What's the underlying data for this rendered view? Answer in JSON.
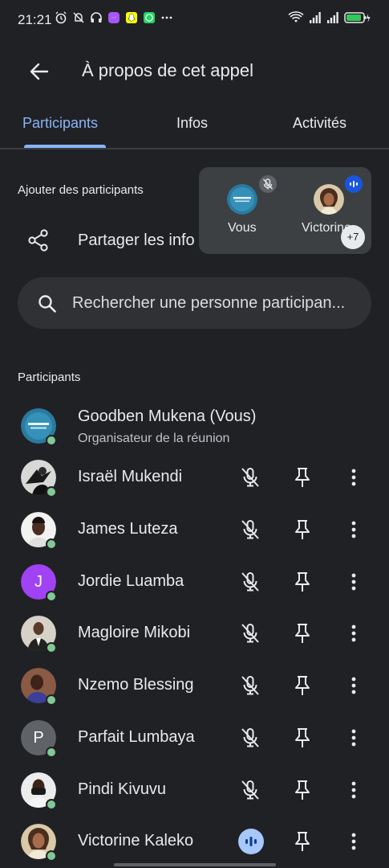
{
  "status_bar": {
    "time": "21:21",
    "icons": [
      "alarm-icon",
      "dnd-icon",
      "headphones-icon",
      "messenger-icon",
      "snapchat-icon",
      "whatsapp-icon",
      "more-notifications-icon"
    ],
    "right_icons": [
      "wifi-icon",
      "signal-icon",
      "signal-icon",
      "battery-icon"
    ]
  },
  "app_bar": {
    "title": "À propos de cet appel"
  },
  "tabs": [
    {
      "label": "Participants",
      "active": true
    },
    {
      "label": "Infos",
      "active": false
    },
    {
      "label": "Activités",
      "active": false
    }
  ],
  "add_section": {
    "label": "Ajouter des participants",
    "share_text": "Partager les info"
  },
  "floating_card": {
    "tiles": [
      {
        "name": "Vous",
        "muted": true
      },
      {
        "name": "Victorine",
        "speaking": true
      }
    ],
    "more_count": "+7"
  },
  "search": {
    "placeholder": "Rechercher une personne participan..."
  },
  "participants_section": {
    "label": "Participants"
  },
  "participants": [
    {
      "name": "Goodben Mukena (Vous)",
      "subtitle": "Organisateur de la réunion",
      "avatar": "logo",
      "mic": "none"
    },
    {
      "name": "Israël Mukendi",
      "avatar": "photo",
      "mic": "muted"
    },
    {
      "name": "James Luteza",
      "avatar": "photo",
      "mic": "muted"
    },
    {
      "name": "Jordie Luamba",
      "avatar": "letter",
      "letter": "J",
      "color": "#a142f4",
      "mic": "muted"
    },
    {
      "name": "Magloire Mikobi",
      "avatar": "photo",
      "mic": "muted"
    },
    {
      "name": "Nzemo Blessing",
      "avatar": "photo",
      "mic": "muted"
    },
    {
      "name": "Parfait Lumbaya",
      "avatar": "letter",
      "letter": "P",
      "color": "#5f6368",
      "mic": "muted"
    },
    {
      "name": "Pindi Kivuvu",
      "avatar": "photo",
      "mic": "muted"
    },
    {
      "name": "Victorine Kaleko",
      "avatar": "photo",
      "mic": "speaking"
    }
  ],
  "colors": {
    "background": "#202124",
    "accent": "#8ab4f8",
    "online": "#81c995",
    "speaking": "#a8c7fa"
  }
}
